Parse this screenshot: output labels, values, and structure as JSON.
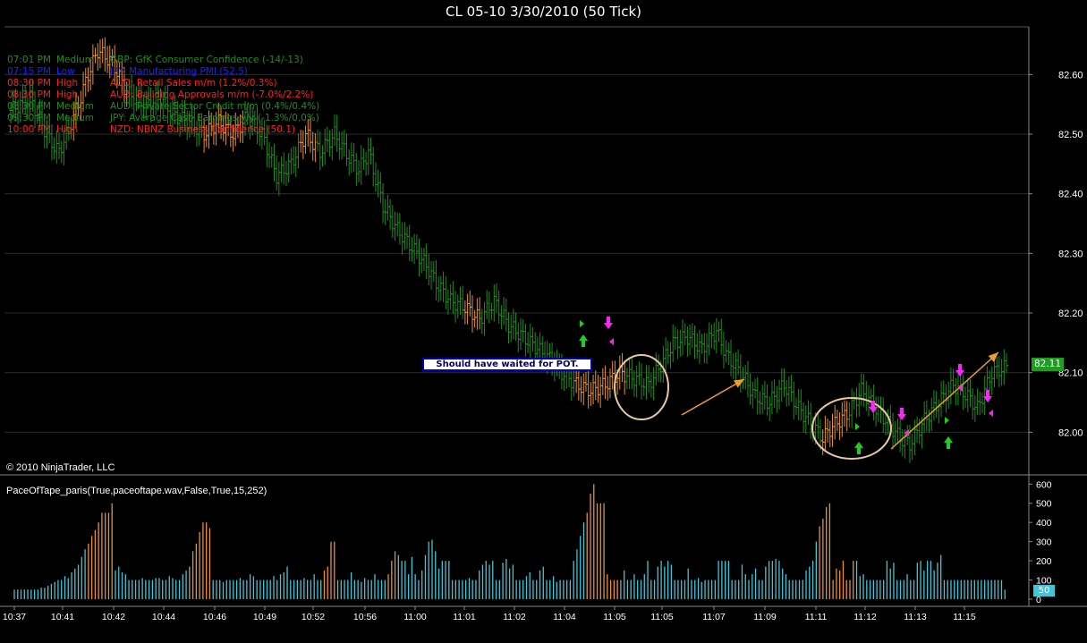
{
  "title": "CL 05-10  3/30/2010 (50 Tick)",
  "copyright": "© 2010 NinjaTrader, LLC",
  "indicator_label": "PaceOfTape_paris(True,paceoftape.wav,False,True,15,252)",
  "annotation_text": "Should have waited for POT.",
  "price_marker": "82.11",
  "volume_marker": "50",
  "colors": {
    "background": "#000000",
    "grid": "#2a2a2a",
    "up_bar": "#1e8c1e",
    "highlight_bar": "#e8922a",
    "pace_bar": "#3fc6d8",
    "pace_hot": "#e8922a",
    "marker_bg": "#1e9e1e",
    "arrow_orange": "#f0a020",
    "arrow_green": "#22cc22",
    "arrow_magenta": "#ff22ff",
    "circle": "#e8c8a0",
    "news_medium": "#1e8c1e",
    "news_low": "#2020ff",
    "news_high": "#ff2020"
  },
  "news": [
    {
      "time": "07:01 PM",
      "importance": "Medium",
      "event": "GBP: GfK Consumer Confidence (-14/-13)",
      "color": "#1e8c1e"
    },
    {
      "time": "07:15 PM",
      "importance": "Low",
      "event": "JPY: Manufacturing PMI (52.5)",
      "color": "#2020ff"
    },
    {
      "time": "08:30 PM",
      "importance": "High",
      "event": "AUD: Retail Sales m/m (1.2%/0.3%)",
      "color": "#ff2020"
    },
    {
      "time": "08:30 PM",
      "importance": "High",
      "event": "AUD: Building Approvals m/m (-7.0%/2.2%)",
      "color": "#ff2020"
    },
    {
      "time": "08:30 PM",
      "importance": "Medium",
      "event": "AUD: Private Sector Credit m/m (0.4%/0.4%)",
      "color": "#1e8c1e"
    },
    {
      "time": "09:30 PM",
      "importance": "Medium",
      "event": "JPY: Average Cash Earnings y/y (-1.3%/0.0%)",
      "color": "#1e8c1e"
    },
    {
      "time": "10:00 PM",
      "importance": "High",
      "event": "NZD: NBNZ Business Confidence (50.1)",
      "color": "#ff2020"
    }
  ],
  "chart_data": [
    {
      "type": "bar",
      "title": "CL 05-10  3/30/2010 (50 Tick)",
      "y_ticks": [
        82.6,
        82.5,
        82.4,
        82.3,
        82.2,
        82.1,
        82.0
      ],
      "ylim": [
        81.93,
        82.68
      ],
      "x_ticks": [
        "10:37",
        "10:41",
        "10:42",
        "10:44",
        "10:46",
        "10:49",
        "10:52",
        "10:56",
        "11:00",
        "11:01",
        "11:02",
        "11:04",
        "11:05",
        "11:05",
        "11:07",
        "11:09",
        "11:11",
        "11:12",
        "11:13",
        "11:15"
      ],
      "grid": true,
      "last_price": 82.11,
      "close_path": [
        [
          0,
          82.54
        ],
        [
          4,
          82.56
        ],
        [
          8,
          82.49
        ],
        [
          10,
          82.47
        ],
        [
          14,
          82.55
        ],
        [
          16,
          82.6
        ],
        [
          18,
          82.64
        ],
        [
          21,
          82.62
        ],
        [
          24,
          82.57
        ],
        [
          28,
          82.55
        ],
        [
          31,
          82.56
        ],
        [
          34,
          82.53
        ],
        [
          37,
          82.52
        ],
        [
          40,
          82.5
        ],
        [
          43,
          82.52
        ],
        [
          46,
          82.5
        ],
        [
          49,
          82.53
        ],
        [
          52,
          82.5
        ],
        [
          55,
          82.43
        ],
        [
          58,
          82.45
        ],
        [
          61,
          82.5
        ],
        [
          64,
          82.47
        ],
        [
          67,
          82.5
        ],
        [
          70,
          82.46
        ],
        [
          72,
          82.44
        ],
        [
          74,
          82.47
        ],
        [
          77,
          82.38
        ],
        [
          80,
          82.34
        ],
        [
          83,
          82.31
        ],
        [
          86,
          82.28
        ],
        [
          88,
          82.25
        ],
        [
          91,
          82.22
        ],
        [
          94,
          82.21
        ],
        [
          97,
          82.19
        ],
        [
          100,
          82.22
        ],
        [
          103,
          82.18
        ],
        [
          106,
          82.16
        ],
        [
          109,
          82.14
        ],
        [
          112,
          82.12
        ],
        [
          114,
          82.1
        ],
        [
          117,
          82.08
        ],
        [
          120,
          82.07
        ],
        [
          123,
          82.08
        ],
        [
          126,
          82.1
        ],
        [
          129,
          82.09
        ],
        [
          132,
          82.08
        ],
        [
          135,
          82.12
        ],
        [
          137,
          82.15
        ],
        [
          140,
          82.16
        ],
        [
          143,
          82.14
        ],
        [
          146,
          82.17
        ],
        [
          148,
          82.13
        ],
        [
          151,
          82.1
        ],
        [
          154,
          82.06
        ],
        [
          157,
          82.05
        ],
        [
          160,
          82.08
        ],
        [
          163,
          82.04
        ],
        [
          166,
          82.01
        ],
        [
          168,
          81.99
        ],
        [
          170,
          82.01
        ],
        [
          173,
          82.03
        ],
        [
          176,
          82.07
        ],
        [
          178,
          82.05
        ],
        [
          181,
          82.02
        ],
        [
          184,
          81.99
        ],
        [
          186,
          81.98
        ],
        [
          189,
          82.02
        ],
        [
          192,
          82.05
        ],
        [
          195,
          82.08
        ],
        [
          198,
          82.06
        ],
        [
          200,
          82.04
        ],
        [
          203,
          82.1
        ],
        [
          206,
          82.11
        ]
      ],
      "highlight_ranges": [
        [
          13,
          24
        ],
        [
          40,
          48
        ],
        [
          60,
          63
        ],
        [
          94,
          97
        ],
        [
          117,
          127
        ],
        [
          168,
          173
        ]
      ]
    },
    {
      "type": "bar",
      "title": "PaceOfTape_paris(True,paceoftape.wav,False,True,15,252)",
      "y_ticks": [
        600,
        500,
        400,
        300,
        200,
        100,
        0
      ],
      "ylim": [
        0,
        620
      ],
      "last_value": 50,
      "values": [
        50,
        50,
        50,
        50,
        50,
        50,
        50,
        50,
        60,
        60,
        70,
        80,
        90,
        100,
        100,
        120,
        110,
        140,
        160,
        180,
        220,
        260,
        290,
        330,
        360,
        400,
        450,
        450,
        450,
        500,
        150,
        170,
        140,
        130,
        100,
        100,
        100,
        100,
        110,
        100,
        100,
        100,
        110,
        110,
        100,
        100,
        120,
        110,
        100,
        100,
        130,
        150,
        170,
        250,
        290,
        350,
        400,
        400,
        370,
        100,
        100,
        100,
        90,
        100,
        100,
        100,
        100,
        110,
        100,
        100,
        130,
        120,
        100,
        100,
        100,
        100,
        100,
        120,
        100,
        130,
        140,
        170,
        100,
        100,
        100,
        100,
        110,
        100,
        100,
        130,
        100,
        100,
        150,
        170,
        300,
        300,
        100,
        100,
        100,
        100,
        140,
        100,
        100,
        90,
        110,
        100,
        100,
        130,
        100,
        100,
        100,
        130,
        200,
        250,
        230,
        200,
        200,
        130,
        220,
        130,
        100,
        150,
        230,
        300,
        310,
        250,
        160,
        200,
        200,
        200,
        100,
        100,
        100,
        100,
        100,
        110,
        100,
        100,
        150,
        180,
        200,
        180,
        200,
        100,
        100,
        190,
        210,
        160,
        180,
        100,
        100,
        100,
        120,
        140,
        100,
        100,
        150,
        170,
        100,
        100,
        120,
        90,
        100,
        100,
        100,
        100,
        200,
        260,
        330,
        400,
        450,
        550,
        600,
        500,
        500,
        500,
        130,
        100,
        100,
        100,
        100,
        150,
        100,
        100,
        130,
        100,
        100,
        130,
        200,
        100,
        100,
        170,
        200,
        170,
        200,
        180,
        100,
        100,
        100,
        100,
        160,
        100,
        100,
        110,
        90,
        100,
        100,
        100,
        100,
        200,
        200,
        200,
        200,
        100,
        100,
        100,
        180,
        130,
        100,
        130,
        160,
        100,
        100,
        170,
        200,
        200,
        210,
        200,
        160,
        130,
        100,
        100,
        100,
        100,
        100,
        150,
        170,
        200,
        300,
        380,
        420,
        480,
        500,
        100,
        160,
        150,
        200,
        100,
        100,
        200,
        200,
        120,
        130,
        100,
        100,
        100,
        100,
        100,
        100,
        200,
        160,
        190,
        100,
        100,
        100,
        130,
        100,
        100,
        190,
        200,
        150,
        200,
        200,
        150,
        190,
        230,
        100,
        100,
        100,
        100,
        100,
        100,
        100,
        100,
        100,
        100,
        100,
        100,
        100,
        100,
        100,
        100,
        100,
        100,
        50
      ],
      "hot_ranges": [
        [
          22,
          29
        ],
        [
          52,
          58
        ],
        [
          92,
          95
        ],
        [
          111,
          113
        ],
        [
          170,
          179
        ],
        [
          239,
          249
        ]
      ]
    }
  ]
}
